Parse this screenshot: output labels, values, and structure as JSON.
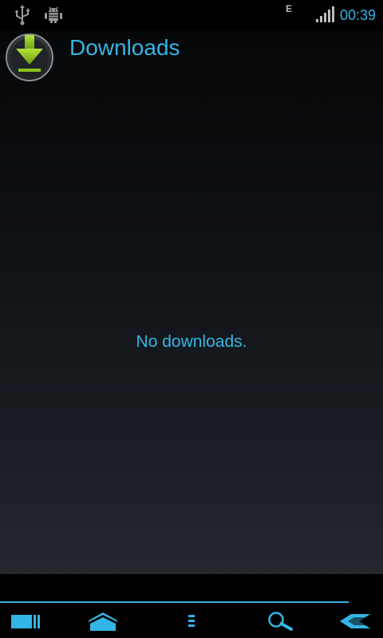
{
  "status_bar": {
    "clock": "00:39",
    "network_type": "E",
    "icons": [
      "usb-icon",
      "android-debug-icon",
      "signal-strength-icon"
    ],
    "accent_color": "#33b5e5"
  },
  "app": {
    "title": "Downloads",
    "logo_icon": "download-arrow-icon"
  },
  "content": {
    "empty_message": "No downloads."
  },
  "navigation": {
    "buttons": [
      "recent-apps-icon",
      "home-icon",
      "menu-icon",
      "search-icon",
      "back-icon"
    ]
  }
}
